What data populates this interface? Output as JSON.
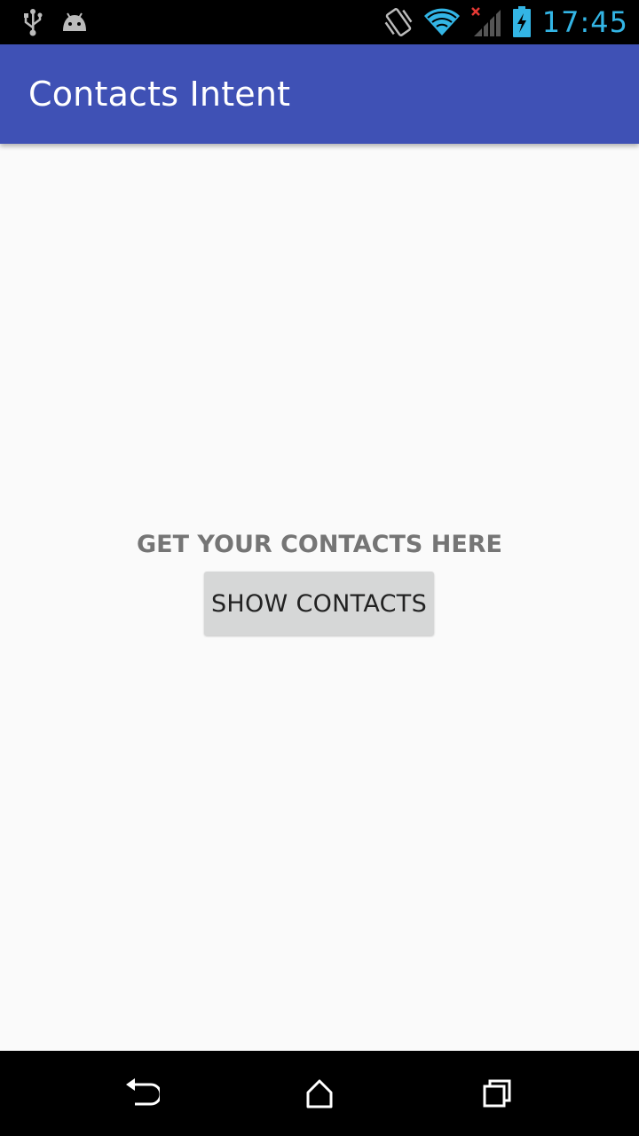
{
  "status_bar": {
    "time": "17:45",
    "icons_left": [
      "usb-icon",
      "android-debug-icon"
    ],
    "icons_right": [
      "vibrate-icon",
      "wifi-icon",
      "signal-no-service-icon",
      "battery-charging-icon"
    ],
    "time_color": "#33b5e5"
  },
  "app_bar": {
    "title": "Contacts Intent",
    "color": "#3f51b5"
  },
  "main": {
    "prompt": "GET YOUR CONTACTS HERE",
    "show_button_label": "SHOW CONTACTS"
  },
  "nav_bar": {
    "buttons": [
      "back-icon",
      "home-icon",
      "recents-icon"
    ]
  }
}
